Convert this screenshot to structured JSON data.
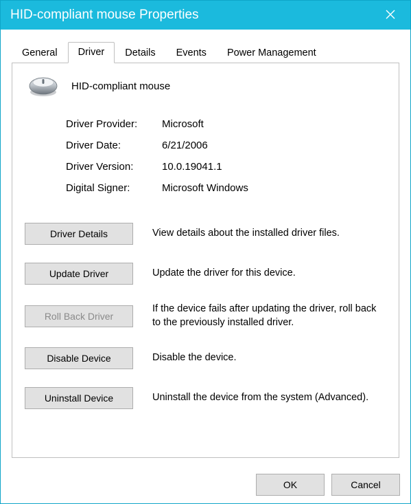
{
  "window": {
    "title": "HID-compliant mouse Properties",
    "close_icon": "close-icon"
  },
  "tabs": {
    "general": "General",
    "driver": "Driver",
    "details": "Details",
    "events": "Events",
    "power": "Power Management",
    "active": "driver"
  },
  "device": {
    "name": "HID-compliant mouse"
  },
  "driver_info": {
    "provider_label": "Driver Provider:",
    "provider_value": "Microsoft",
    "date_label": "Driver Date:",
    "date_value": "6/21/2006",
    "version_label": "Driver Version:",
    "version_value": "10.0.19041.1",
    "signer_label": "Digital Signer:",
    "signer_value": "Microsoft Windows"
  },
  "actions": {
    "details": {
      "label": "Driver Details",
      "desc": "View details about the installed driver files."
    },
    "update": {
      "label": "Update Driver",
      "desc": "Update the driver for this device."
    },
    "rollback": {
      "label": "Roll Back Driver",
      "desc": "If the device fails after updating the driver, roll back to the previously installed driver."
    },
    "disable": {
      "label": "Disable Device",
      "desc": "Disable the device."
    },
    "uninstall": {
      "label": "Uninstall Device",
      "desc": "Uninstall the device from the system (Advanced)."
    }
  },
  "footer": {
    "ok": "OK",
    "cancel": "Cancel"
  }
}
